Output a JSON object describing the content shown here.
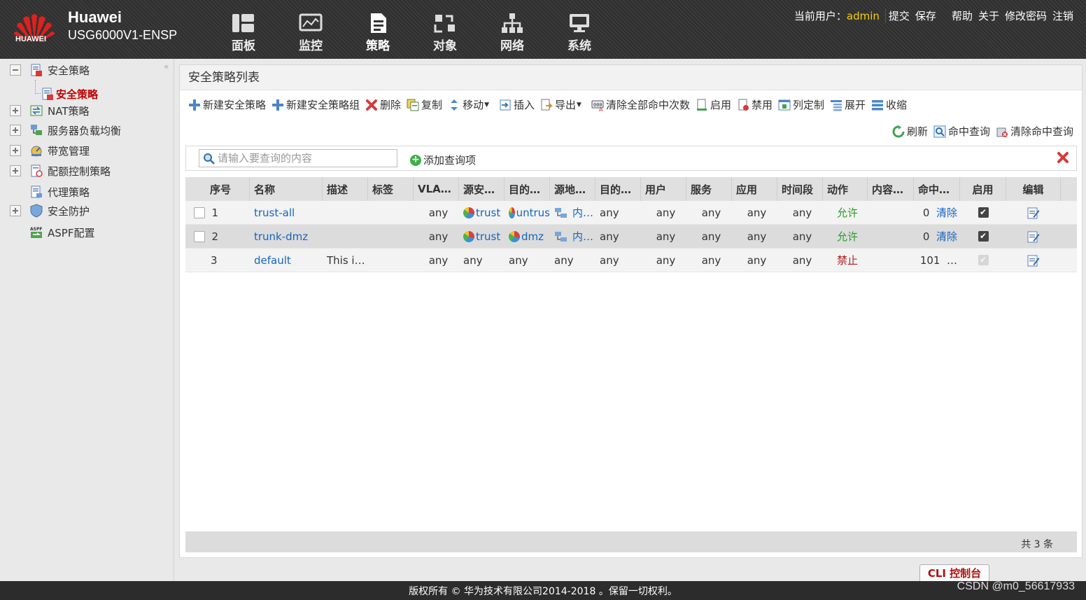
{
  "header": {
    "brand_name": "Huawei",
    "device_model": "USG6000V1-ENSP",
    "logo_text": "HUAWEI",
    "nav": [
      {
        "label": "面板",
        "icon": "dashboard-icon"
      },
      {
        "label": "监控",
        "icon": "monitor-icon"
      },
      {
        "label": "策略",
        "icon": "policy-icon"
      },
      {
        "label": "对象",
        "icon": "object-icon"
      },
      {
        "label": "网络",
        "icon": "network-icon"
      },
      {
        "label": "系统",
        "icon": "system-icon"
      }
    ],
    "current_user_label": "当前用户：",
    "current_user": "admin",
    "actions": [
      "提交",
      "保存",
      "帮助",
      "关于",
      "修改密码",
      "注销"
    ]
  },
  "sidebar": {
    "collapse_glyph": "«",
    "items": [
      {
        "label": "安全策略",
        "expander": "minus",
        "icon": "security-policy-icon"
      },
      {
        "label": "NAT策略",
        "expander": "plus",
        "icon": "nat-icon"
      },
      {
        "label": "服务器负载均衡",
        "expander": "plus",
        "icon": "server-lb-icon"
      },
      {
        "label": "带宽管理",
        "expander": "plus",
        "icon": "bandwidth-icon"
      },
      {
        "label": "配额控制策略",
        "expander": "plus",
        "icon": "quota-icon"
      },
      {
        "label": "代理策略",
        "expander": "none",
        "icon": "proxy-icon"
      },
      {
        "label": "安全防护",
        "expander": "plus",
        "icon": "shield-icon"
      },
      {
        "label": "ASPF配置",
        "expander": "none",
        "icon": "aspf-icon"
      }
    ],
    "selected_sub": "安全策略"
  },
  "panel": {
    "title": "安全策略列表",
    "toolbar": [
      {
        "label": "新建安全策略",
        "icon": "add-icon"
      },
      {
        "label": "新建安全策略组",
        "icon": "add-icon"
      },
      {
        "label": "删除",
        "icon": "delete-icon"
      },
      {
        "label": "复制",
        "icon": "copy-icon"
      },
      {
        "label": "移动",
        "icon": "move-icon",
        "dropdown": true
      },
      {
        "label": "插入",
        "icon": "insert-icon"
      },
      {
        "label": "导出",
        "icon": "export-icon",
        "dropdown": true
      },
      {
        "label": "清除全部命中次数",
        "icon": "clear-hits-icon"
      },
      {
        "label": "启用",
        "icon": "enable-icon"
      },
      {
        "label": "禁用",
        "icon": "disable-icon"
      },
      {
        "label": "列定制",
        "icon": "columns-icon"
      },
      {
        "label": "展开",
        "icon": "expand-icon"
      },
      {
        "label": "收缩",
        "icon": "collapse-icon"
      }
    ],
    "toolbar2": [
      {
        "label": "刷新",
        "icon": "refresh-icon"
      },
      {
        "label": "命中查询",
        "icon": "hit-query-icon"
      },
      {
        "label": "清除命中查询",
        "icon": "clear-hit-query-icon"
      }
    ],
    "search_placeholder": "请输入要查询的内容",
    "add_query_label": "添加查询项",
    "columns": [
      "序号",
      "名称",
      "描述",
      "标签",
      "VLA…",
      "源安…",
      "目的…",
      "源地…",
      "目的…",
      "用户",
      "服务",
      "应用",
      "时间段",
      "动作",
      "内容…",
      "命中…",
      "启用",
      "编辑"
    ],
    "rows": [
      {
        "seq": "1",
        "name": "trust-all",
        "desc": "",
        "tag": "",
        "vlan": "any",
        "src_zone": "trust",
        "dst_zone": "untrus",
        "src_addr": "内…",
        "dst_addr": "any",
        "user": "any",
        "service": "any",
        "app": "any",
        "time": "any",
        "action": "允许",
        "action_type": "allow",
        "content": "",
        "hits": "0",
        "clear_label": "清除",
        "enabled": true,
        "enabled_disabled": false
      },
      {
        "seq": "2",
        "name": "trunk-dmz",
        "desc": "",
        "tag": "",
        "vlan": "any",
        "src_zone": "trust",
        "dst_zone": "dmz",
        "src_addr": "内…",
        "dst_addr": "any",
        "user": "any",
        "service": "any",
        "app": "any",
        "time": "any",
        "action": "允许",
        "action_type": "allow",
        "content": "",
        "hits": "0",
        "clear_label": "清除",
        "enabled": true,
        "enabled_disabled": false
      },
      {
        "seq": "3",
        "name": "default",
        "desc": "This i…",
        "tag": "",
        "vlan": "any",
        "src_zone": "any",
        "dst_zone": "any",
        "src_addr": "any",
        "dst_addr": "any",
        "user": "any",
        "service": "any",
        "app": "any",
        "time": "any",
        "action": "禁止",
        "action_type": "deny",
        "content": "",
        "hits": "101",
        "clear_label": "…",
        "enabled": true,
        "enabled_disabled": true
      }
    ],
    "total": "共 3 条"
  },
  "cli_label": "CLI 控制台",
  "copyright": "版权所有 © 华为技术有限公司2014-2018 。保留一切权利。",
  "watermark": "CSDN @m0_56617933",
  "colors": {
    "accent_red": "#c00000",
    "link_blue": "#1565c0",
    "allow_green": "#2a9d2a",
    "user_yellow": "#f6d000"
  }
}
